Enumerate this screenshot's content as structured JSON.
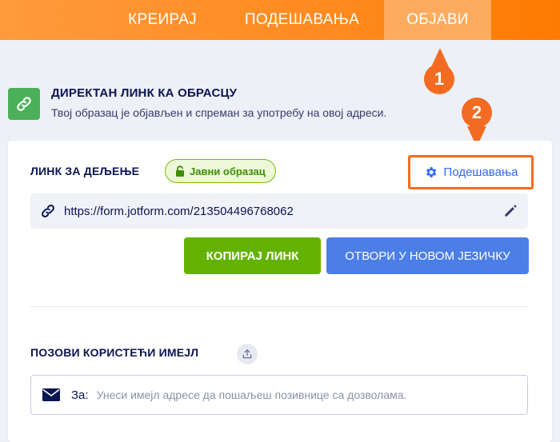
{
  "nav": {
    "tabs": [
      {
        "label": "КРЕИРАЈ"
      },
      {
        "label": "ПОДЕШАВАЊА"
      },
      {
        "label": "ОБЈАВИ",
        "active": true
      }
    ]
  },
  "markers": [
    "1",
    "2"
  ],
  "header": {
    "title": "ДИРЕКТАН ЛИНК КА ОБРАСЦУ",
    "subtitle": "Твој образац је објављен и спреман за употребу на овој адреси."
  },
  "share": {
    "label": "ЛИНК ЗА ДЕЉЕЊЕ",
    "badge": "Јавни образац",
    "settings_label": "Подешавања",
    "url": "https://form.jotform.com/213504496768062",
    "copy_label": "КОПИРАЈ ЛИНК",
    "open_label": "ОТВОРИ У НОВОМ ЈЕЗИЧКУ"
  },
  "invite": {
    "label": "ПОЗОВИ КОРИСТЕЋИ ИМЕЈЛ",
    "to_label": "За:",
    "placeholder": "Унеси имејл адресе да пошаљеш позивнице са дозволама."
  },
  "colors": {
    "nav_orange": "#ff8a1f",
    "marker": "#f26b21",
    "green": "#64b200",
    "blue": "#4c7ee8",
    "link_blue": "#2e69ff"
  },
  "icons": [
    "link-icon",
    "lock-icon",
    "gear-icon",
    "chain-icon",
    "pencil-icon",
    "upload-icon",
    "envelope-icon"
  ]
}
